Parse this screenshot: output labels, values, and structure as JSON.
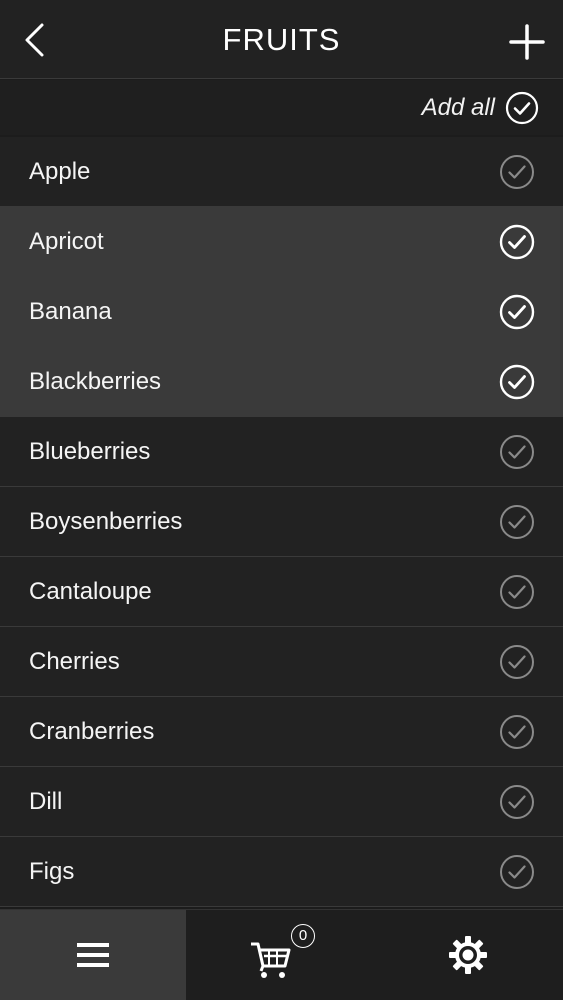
{
  "header": {
    "title": "FRUITS",
    "back_icon": "chevron-left-icon",
    "add_icon": "plus-icon"
  },
  "add_all": {
    "label": "Add all",
    "icon": "check-circle-icon"
  },
  "colors": {
    "background": "#222222",
    "selected_row": "#3a3a3a",
    "check_selected": "#ffffff",
    "check_unselected": "#8a8a8a"
  },
  "items": [
    {
      "label": "Apple",
      "selected": false
    },
    {
      "label": "Apricot",
      "selected": true
    },
    {
      "label": "Banana",
      "selected": true
    },
    {
      "label": "Blackberries",
      "selected": true
    },
    {
      "label": "Blueberries",
      "selected": false
    },
    {
      "label": "Boysenberries",
      "selected": false
    },
    {
      "label": "Cantaloupe",
      "selected": false
    },
    {
      "label": "Cherries",
      "selected": false
    },
    {
      "label": "Cranberries",
      "selected": false
    },
    {
      "label": "Dill",
      "selected": false
    },
    {
      "label": "Figs",
      "selected": false
    }
  ],
  "tabbar": {
    "list_icon": "menu-icon",
    "cart_icon": "cart-icon",
    "cart_count": "0",
    "settings_icon": "gear-icon",
    "active_tab": "list"
  }
}
